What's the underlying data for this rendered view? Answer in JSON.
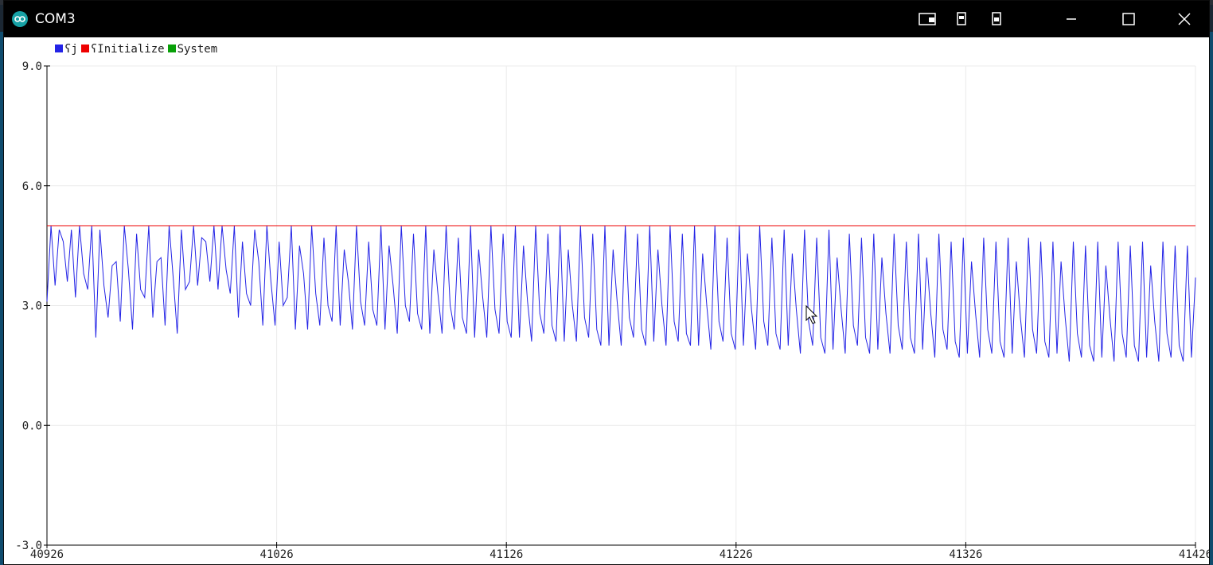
{
  "window": {
    "title": "COM3",
    "controls": [
      "autoscroll-icon",
      "window-mode-icon",
      "window-mode-icon",
      "minimize-icon",
      "maximize-icon",
      "close-icon"
    ]
  },
  "colors": {
    "titlebar_bg": "#000000",
    "series_sj": "#2323e6",
    "series_initialize": "#ee0000",
    "series_system": "#08a008",
    "grid": "#ebebeb"
  },
  "chart_data": {
    "type": "line",
    "title": "",
    "xlabel": "",
    "ylabel": "",
    "xlim": [
      40926,
      41426
    ],
    "ylim": [
      -3.0,
      9.0
    ],
    "x_ticks": [
      40926,
      41026,
      41126,
      41226,
      41326,
      41426
    ],
    "y_ticks": [
      9.0,
      6.0,
      3.0,
      0.0,
      -3.0
    ],
    "x_tick_labels": [
      "40926",
      "41026",
      "41126",
      "41226",
      "41326",
      "41426"
    ],
    "y_tick_labels": [
      "9.0",
      "6.0",
      "3.0",
      "0.0",
      "-3.0"
    ],
    "grid": true,
    "legend_position": "top-left",
    "legend": [
      {
        "name": "ʕj",
        "color": "#2323e6"
      },
      {
        "name": "ʕInitialize",
        "color": "#ee0000"
      },
      {
        "name": "System",
        "color": "#08a008"
      }
    ],
    "series": [
      {
        "name": "ʕj",
        "color": "#2323e6",
        "x_start": 40926,
        "x_step": 1,
        "pattern_note_removed": true,
        "values": [
          3.1,
          5.0,
          3.5,
          4.9,
          4.6,
          3.6,
          4.9,
          3.2,
          5.0,
          3.8,
          3.4,
          5.0,
          2.2,
          4.9,
          3.5,
          2.7,
          4.0,
          4.1,
          2.6,
          5.0,
          3.9,
          2.4,
          4.8,
          3.4,
          3.2,
          5.0,
          2.7,
          4.1,
          4.2,
          2.5,
          5.0,
          3.7,
          2.3,
          4.9,
          3.4,
          3.6,
          5.0,
          3.5,
          4.7,
          4.6,
          3.6,
          5.0,
          3.4,
          5.0,
          3.9,
          3.3,
          5.0,
          2.7,
          4.6,
          3.3,
          3.0,
          4.9,
          4.1,
          2.5,
          5.0,
          3.6,
          2.5,
          4.6,
          3.0,
          3.2,
          5.0,
          2.4,
          4.5,
          3.8,
          2.4,
          5.0,
          3.3,
          2.5,
          4.7,
          3.0,
          2.6,
          5.0,
          2.5,
          4.4,
          3.6,
          2.4,
          5.0,
          3.1,
          2.5,
          4.6,
          2.9,
          2.5,
          5.0,
          2.4,
          4.5,
          3.5,
          2.3,
          5.0,
          3.0,
          2.6,
          4.8,
          2.8,
          2.4,
          5.0,
          2.3,
          4.4,
          3.3,
          2.3,
          5.0,
          3.0,
          2.4,
          4.7,
          2.7,
          2.3,
          5.0,
          2.2,
          4.4,
          3.2,
          2.2,
          5.0,
          2.9,
          2.3,
          4.8,
          2.6,
          2.2,
          5.0,
          2.2,
          4.5,
          3.1,
          2.1,
          5.0,
          2.8,
          2.3,
          4.8,
          2.5,
          2.1,
          5.0,
          2.1,
          4.4,
          3.0,
          2.1,
          5.0,
          2.7,
          2.2,
          4.8,
          2.4,
          2.0,
          5.0,
          2.0,
          4.4,
          3.1,
          2.0,
          5.0,
          2.7,
          2.2,
          4.8,
          2.4,
          2.0,
          5.0,
          2.1,
          4.4,
          3.0,
          2.0,
          5.0,
          2.6,
          2.1,
          4.8,
          2.3,
          2.0,
          5.0,
          2.0,
          4.3,
          3.0,
          1.9,
          5.0,
          2.6,
          2.1,
          4.7,
          2.3,
          1.9,
          5.0,
          2.0,
          4.3,
          2.9,
          1.9,
          5.0,
          2.6,
          2.0,
          4.7,
          2.3,
          1.9,
          4.9,
          2.0,
          4.3,
          2.9,
          1.8,
          4.9,
          2.6,
          2.0,
          4.7,
          2.2,
          1.8,
          4.9,
          1.9,
          4.2,
          2.9,
          1.8,
          4.8,
          2.5,
          2.0,
          4.7,
          2.2,
          1.8,
          4.8,
          1.9,
          4.2,
          2.8,
          1.8,
          4.8,
          2.5,
          1.9,
          4.6,
          2.2,
          1.8,
          4.8,
          1.9,
          4.2,
          2.8,
          1.7,
          4.8,
          2.4,
          1.9,
          4.6,
          2.1,
          1.7,
          4.7,
          1.8,
          4.1,
          2.8,
          1.7,
          4.7,
          2.4,
          1.8,
          4.6,
          2.1,
          1.7,
          4.7,
          1.8,
          4.1,
          2.7,
          1.7,
          4.7,
          2.4,
          1.8,
          4.6,
          2.1,
          1.7,
          4.6,
          1.8,
          4.1,
          2.7,
          1.6,
          4.6,
          2.3,
          1.7,
          4.5,
          2.0,
          1.6,
          4.6,
          1.7,
          4.0,
          2.7,
          1.6,
          4.6,
          2.3,
          1.7,
          4.5,
          2.0,
          1.6,
          4.6,
          1.7,
          4.0,
          2.6,
          1.6,
          4.6,
          2.3,
          1.7,
          4.5,
          2.0,
          1.6,
          4.5,
          1.7,
          3.7
        ]
      },
      {
        "name": "ʕInitialize",
        "color": "#ee0000",
        "constant": 5.0
      }
    ]
  }
}
